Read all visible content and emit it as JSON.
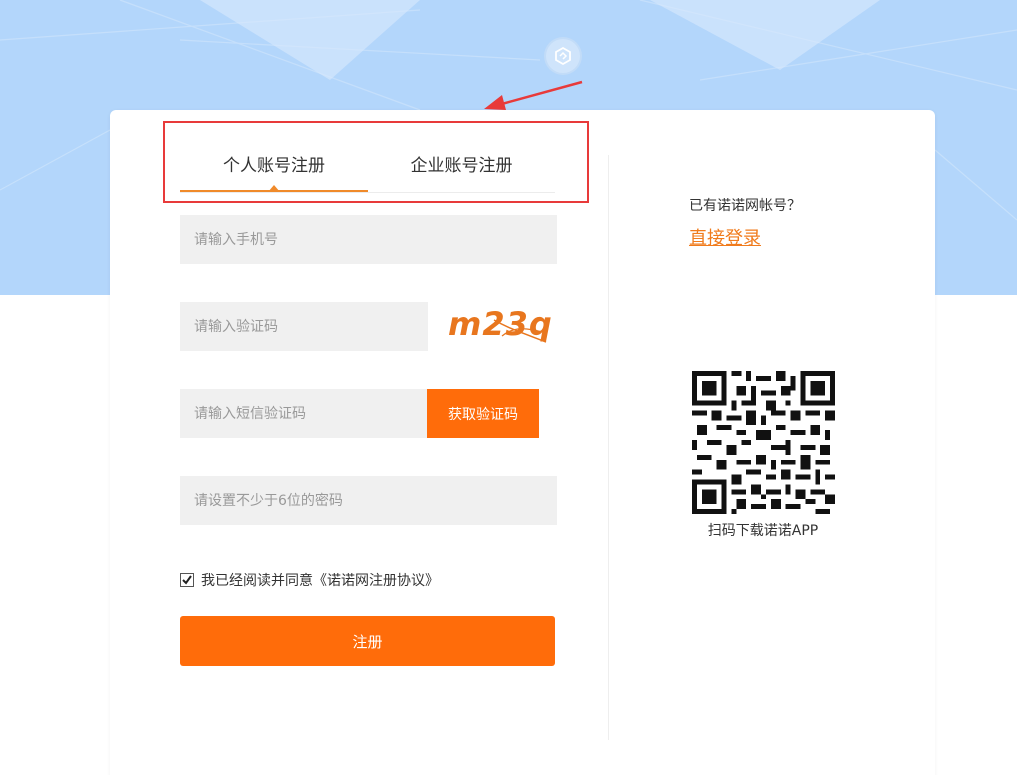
{
  "tabs": [
    {
      "label": "个人账号注册",
      "active": true
    },
    {
      "label": "企业账号注册",
      "active": false
    }
  ],
  "form": {
    "phone_placeholder": "请输入手机号",
    "captcha_placeholder": "请输入验证码",
    "captcha_code": "m23q",
    "sms_placeholder": "请输入短信验证码",
    "sms_button_label": "获取验证码",
    "password_placeholder": "请设置不少于6位的密码",
    "agree_prefix": "我已经阅读并同意",
    "agree_link": "《诺诺网注册协议》",
    "agree_checked": true,
    "register_label": "注册"
  },
  "aside": {
    "have_account": "已有诺诺网帐号？",
    "login_link": "直接登录",
    "qr_caption": "扫码下载诺诺APP"
  },
  "colors": {
    "accent": "#ff6c0a",
    "link": "#f07b1c",
    "hero_background": "#b3d6fb",
    "annotation_red": "#e83a3a"
  },
  "icons": {
    "logo": "hexagon-logo-icon",
    "checkbox": "checkmark-icon",
    "arrow": "annotation-arrow-icon"
  }
}
